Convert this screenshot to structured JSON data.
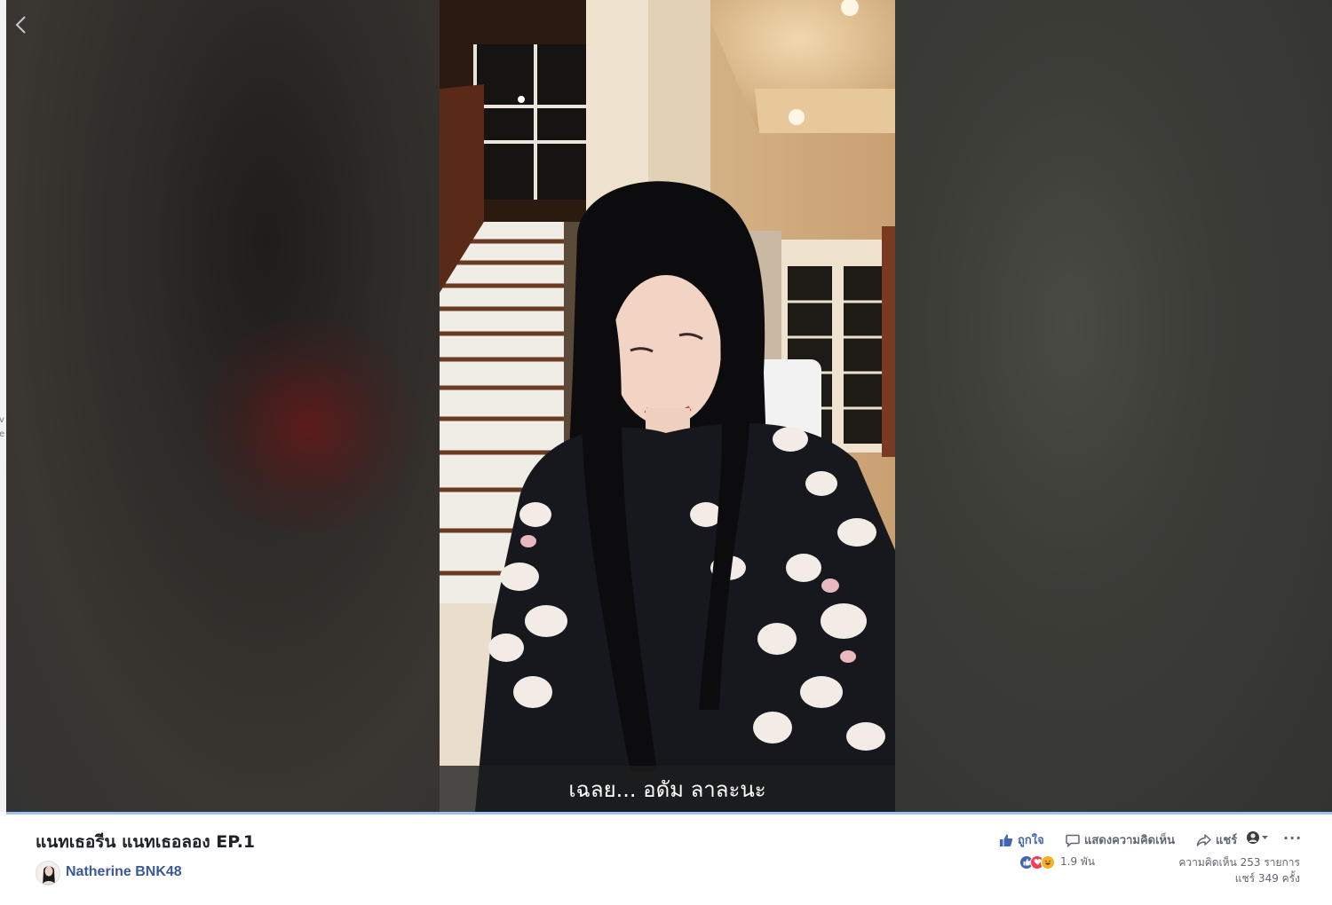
{
  "video": {
    "subtitle": "เฉลย... อดัม ลาละนะ"
  },
  "left_strip": {
    "line1": "v",
    "line2": "e"
  },
  "post": {
    "title": "แนทเธอรีน แนทเธอลอง EP.1",
    "page_name": "Natherine BNK48"
  },
  "actions": {
    "like": "ถูกใจ",
    "comment": "แสดงความคิดเห็น",
    "share": "แชร์",
    "more": "···"
  },
  "stats": {
    "reactions_count": "1.9 พัน",
    "comments": "ความคิดเห็น 253 รายการ",
    "shares": "แชร์ 349 ครั้ง"
  },
  "colors": {
    "facebook_blue": "#4267b2",
    "page_link": "#385898",
    "love_red": "#f33e58",
    "haha_yellow": "#f7b125"
  },
  "icons": {
    "back": "chevron-left-icon",
    "like": "thumbs-up-icon",
    "comment": "speech-bubble-icon",
    "share": "share-arrow-icon",
    "audience": "avatar-dropdown-icon"
  }
}
